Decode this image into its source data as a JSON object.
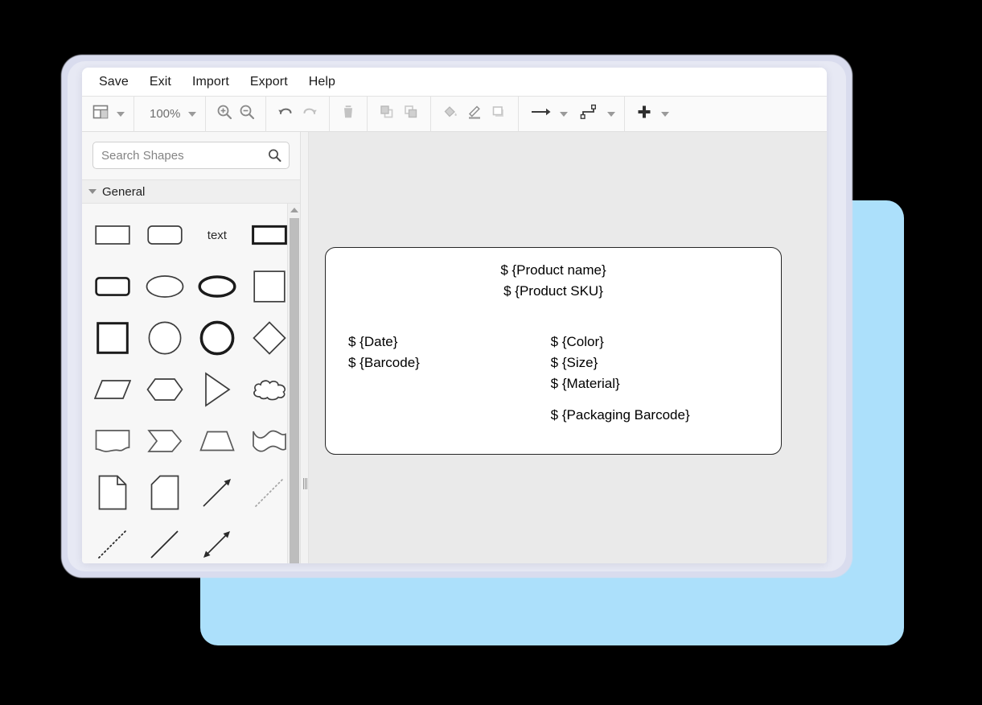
{
  "window": {
    "menu": [
      {
        "label": "Save",
        "name": "menu-save"
      },
      {
        "label": "Exit",
        "name": "menu-exit"
      },
      {
        "label": "Import",
        "name": "menu-import"
      },
      {
        "label": "Export",
        "name": "menu-export"
      },
      {
        "label": "Help",
        "name": "menu-help"
      }
    ],
    "toolbar": {
      "view_icon": "layout-panels-icon",
      "zoom_level": "100%",
      "zoom_in_icon": "zoom-in-icon",
      "zoom_out_icon": "zoom-out-icon",
      "undo_icon": "undo-icon",
      "redo_icon": "redo-icon",
      "delete_icon": "trash-icon",
      "to_front_icon": "bring-to-front-icon",
      "to_back_icon": "send-to-back-icon",
      "fill_icon": "fill-color-icon",
      "line_icon": "line-color-icon",
      "shadow_icon": "shadow-icon",
      "edge_style_icon": "arrow-connector-icon",
      "waypoint_icon": "waypoint-connector-icon",
      "insert_icon": "plus-icon"
    }
  },
  "sidebar": {
    "search": {
      "placeholder": "Search Shapes",
      "value": "",
      "icon": "search-icon"
    },
    "section": {
      "title": "General",
      "expanded": true,
      "caret_icon": "chevron-down-icon"
    },
    "shapes": [
      {
        "name": "shape-rectangle",
        "label": ""
      },
      {
        "name": "shape-rounded-rectangle",
        "label": ""
      },
      {
        "name": "shape-text",
        "label": "text"
      },
      {
        "name": "shape-thick-rectangle",
        "label": ""
      },
      {
        "name": "shape-rounded-thick-rect",
        "label": ""
      },
      {
        "name": "shape-ellipse",
        "label": ""
      },
      {
        "name": "shape-thick-ellipse",
        "label": ""
      },
      {
        "name": "shape-square",
        "label": ""
      },
      {
        "name": "shape-thick-square",
        "label": ""
      },
      {
        "name": "shape-circle",
        "label": ""
      },
      {
        "name": "shape-thick-circle",
        "label": ""
      },
      {
        "name": "shape-diamond",
        "label": ""
      },
      {
        "name": "shape-parallelogram",
        "label": ""
      },
      {
        "name": "shape-hexagon",
        "label": ""
      },
      {
        "name": "shape-triangle",
        "label": ""
      },
      {
        "name": "shape-cloud",
        "label": ""
      },
      {
        "name": "shape-document",
        "label": ""
      },
      {
        "name": "shape-chevron",
        "label": ""
      },
      {
        "name": "shape-trapezoid",
        "label": ""
      },
      {
        "name": "shape-tape",
        "label": ""
      },
      {
        "name": "shape-note",
        "label": ""
      },
      {
        "name": "shape-card",
        "label": ""
      },
      {
        "name": "shape-arrow-line",
        "label": ""
      },
      {
        "name": "shape-dotted-line-arrow",
        "label": ""
      },
      {
        "name": "shape-dotted-line",
        "label": ""
      },
      {
        "name": "shape-solid-line",
        "label": ""
      },
      {
        "name": "shape-double-arrow-line",
        "label": ""
      }
    ],
    "scrollbar": {
      "up_arrow_icon": "scroll-up-arrow-icon",
      "thumb": "scroll-thumb"
    }
  },
  "canvas": {
    "node": {
      "title_lines": [
        "$ {Product name}",
        "$ {Product SKU}"
      ],
      "left_column": [
        "$ {Date}",
        "$ {Barcode}"
      ],
      "right_column": [
        "$ {Color}",
        "$ {Size}",
        "$ {Material}"
      ],
      "right_column_footer": "$ {Packaging Barcode}"
    }
  },
  "colors": {
    "backdrop": "#000000",
    "blue_card": "#ACE0FB",
    "window_frame": "#D9DCEE",
    "canvas_bg": "#EAEAEA",
    "panel_bg": "#F7F7F7",
    "toolbar_bg": "#FAFAFA",
    "node_border": "#262626"
  }
}
